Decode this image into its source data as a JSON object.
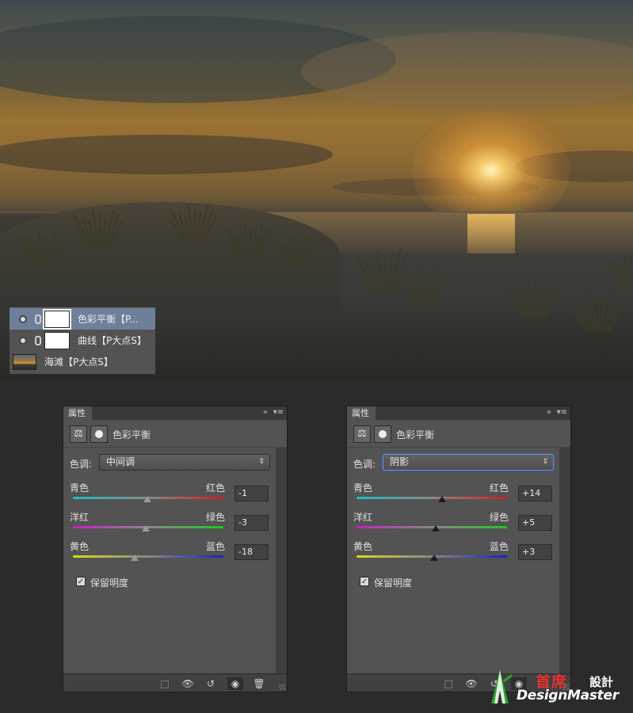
{
  "layers": [
    {
      "name": "色彩平衡【P...",
      "selected": true
    },
    {
      "name": "曲线【P大点S】",
      "selected": false
    },
    {
      "name": "海滩【P大点S】",
      "selected": false
    }
  ],
  "panels": [
    {
      "tab": "属性",
      "title": "色彩平衡",
      "tone_label": "色调:",
      "tone_value": "中间调",
      "sliders": [
        {
          "left": "青色",
          "right": "红色",
          "value": "-1",
          "level": -1
        },
        {
          "left": "洋红",
          "right": "绿色",
          "value": "-3",
          "level": -3
        },
        {
          "left": "黄色",
          "right": "蓝色",
          "value": "-18",
          "level": -18
        }
      ],
      "preserve_label": "保留明度",
      "preserve_checked": true
    },
    {
      "tab": "属性",
      "title": "色彩平衡",
      "tone_label": "色调:",
      "tone_value": "阴影",
      "sliders": [
        {
          "left": "青色",
          "right": "红色",
          "value": "+14",
          "level": 14
        },
        {
          "left": "洋红",
          "right": "绿色",
          "value": "+5",
          "level": 5
        },
        {
          "left": "黄色",
          "right": "蓝色",
          "value": "+3",
          "level": 3
        }
      ],
      "preserve_label": "保留明度",
      "preserve_checked": true
    }
  ],
  "icons": {
    "collapse": "»",
    "menu": "▾≡",
    "checkmark": "✓",
    "select_arrow": "⇕",
    "balance": "⚖",
    "clip": "⬚",
    "view_previous": "👁",
    "reset": "↺",
    "visibility": "◉",
    "trash": "🗑"
  },
  "watermark": {
    "cn": "首席",
    "cn2": "設計",
    "en": "DesignMaster"
  },
  "colors": {
    "cyan_red": [
      "#1fbfbf",
      "#d21e1e"
    ],
    "magenta_green": [
      "#c91ec9",
      "#1ec91e"
    ],
    "yellow_blue": [
      "#d9d91e",
      "#1e1ec9"
    ],
    "watermark_red": "#e8312b"
  }
}
